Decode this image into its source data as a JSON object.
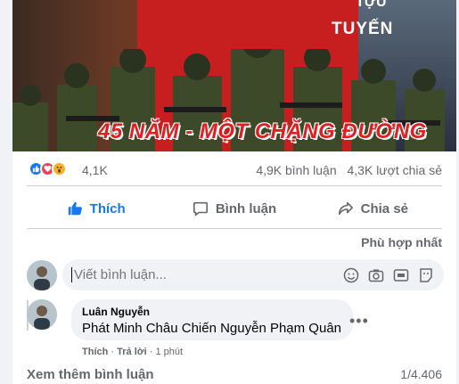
{
  "hero": {
    "title_top": "TỰU",
    "title_word": "TUYẾN",
    "banner_text": "45 NĂM - MỘT CHẶNG ĐƯỜNG"
  },
  "stats": {
    "reaction_count": "4,1K",
    "comments": "4,9K bình luận",
    "shares": "4,3K lượt chia sẻ"
  },
  "actions": {
    "like": "Thích",
    "comment": "Bình luận",
    "share": "Chia sẻ"
  },
  "sort_label": "Phù hợp nhất",
  "composer": {
    "placeholder": "Viết bình luận..."
  },
  "comment": {
    "author": "Luân Nguyễn",
    "text": "Phát Minh Châu Chiến Nguyễn Phạm Quân",
    "like": "Thích",
    "reply": "Trả lời",
    "time": "1 phút"
  },
  "footer": {
    "view_more": "Xem thêm bình luận",
    "pager": "1/4.406"
  },
  "colors": {
    "accent": "#1877f2",
    "love": "#f33e58",
    "wow": "#f7b125",
    "hero_red": "#c71f1f"
  }
}
